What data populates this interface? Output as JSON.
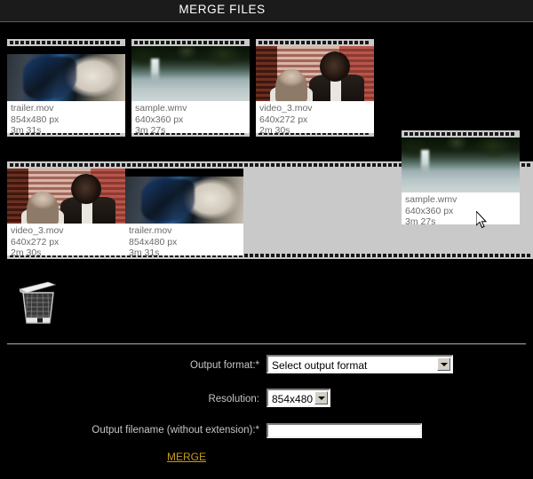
{
  "header": {
    "title": "MERGE FILES"
  },
  "library_strip": {
    "name": "source-clips",
    "clips": [
      {
        "filename": "trailer.mov",
        "resolution": "854x480 px",
        "duration": "3m 31s",
        "art": "art-trailer"
      },
      {
        "filename": "sample.wmv",
        "resolution": "640x360 px",
        "duration": "3m 27s",
        "art": "art-sample"
      },
      {
        "filename": "video_3.mov",
        "resolution": "640x272 px",
        "duration": "2m 30s",
        "art": "art-video3"
      }
    ]
  },
  "timeline_strip": {
    "name": "merge-timeline",
    "clips": [
      {
        "filename": "video_3.mov",
        "resolution": "640x272 px",
        "duration": "2m 30s",
        "art": "art-video3"
      },
      {
        "filename": "trailer.mov",
        "resolution": "854x480 px",
        "duration": "3m 31s",
        "art": "art-trailer"
      }
    ]
  },
  "dragged_clip": {
    "filename": "sample.wmv",
    "resolution": "640x360 px",
    "duration": "3m 27s",
    "art": "art-sample"
  },
  "trash": {
    "icon": "trash-can-icon"
  },
  "form": {
    "output_format": {
      "label": "Output format:*",
      "value": "Select output format",
      "options": [
        "Select output format"
      ]
    },
    "resolution": {
      "label": "Resolution:",
      "value": "854x480",
      "options": [
        "854x480"
      ]
    },
    "filename": {
      "label": "Output filename (without extension):*",
      "value": "",
      "placeholder": ""
    },
    "submit_label": "MERGE"
  },
  "colors": {
    "background": "#000000",
    "header_bar": "#1b1b1b",
    "film_strip": "#c9c9c9",
    "meta_panel": "#ffffff",
    "meta_text": "#6a6a6a",
    "accent_link": "#c89b1a",
    "label_text": "#c6c6c6",
    "divider": "#8f8f8f"
  }
}
